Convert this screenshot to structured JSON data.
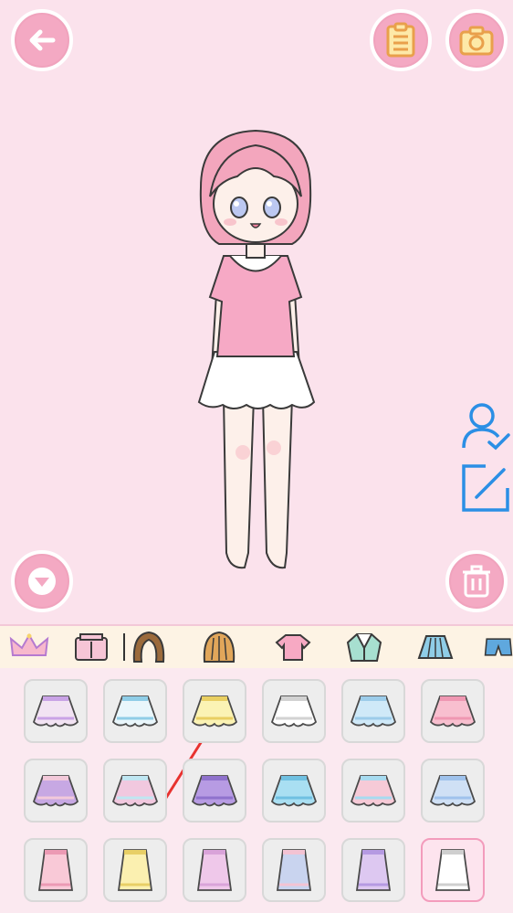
{
  "toolbar": {
    "back": "back-arrow-icon",
    "list": "clipboard-list-icon",
    "camera": "camera-icon",
    "collapse": "chevron-down-icon",
    "delete": "trash-icon"
  },
  "side": {
    "profile": "user-check-icon",
    "edit": "edit-icon"
  },
  "colors": {
    "stage_bg": "#fbe2ec",
    "button_pink": "#f4a9c3",
    "accent_blue": "#2b8fe5",
    "selected_tile": "#fde4ee"
  },
  "categories": [
    {
      "name": "crown-icon",
      "active": true
    },
    {
      "name": "wardrobe-icon",
      "active": false
    },
    {
      "name": "hair-dark-icon",
      "active": false
    },
    {
      "name": "hair-light-icon",
      "active": false
    },
    {
      "name": "shirt-icon",
      "active": false
    },
    {
      "name": "jacket-icon",
      "active": false
    },
    {
      "name": "skirt-icon",
      "active": false
    },
    {
      "name": "shorts-icon",
      "active": false
    }
  ],
  "items": [
    {
      "name": "skirt-tutu-lavender",
      "color": "#f2e3f3",
      "accent": "#c9a3e6"
    },
    {
      "name": "skirt-white-bows",
      "color": "#e9f6fb",
      "accent": "#8fcde7"
    },
    {
      "name": "skirt-yellow-buttons",
      "color": "#fbf3b4",
      "accent": "#e9cf62"
    },
    {
      "name": "skirt-white-asymmetric",
      "color": "#ffffff",
      "accent": "#d2d2d2"
    },
    {
      "name": "skirt-blue-asymmetric",
      "color": "#cfe9f8",
      "accent": "#9cccea"
    },
    {
      "name": "skirt-pink-plain",
      "color": "#f8bfcf",
      "accent": "#ef97b2"
    },
    {
      "name": "skirt-rainbow-pleated",
      "color": "#c7a8e3",
      "accent": "#f2c9da"
    },
    {
      "name": "skirt-pastel-rainbow",
      "color": "#f1c8df",
      "accent": "#bfe6f2"
    },
    {
      "name": "skirt-purple-ruffle",
      "color": "#b79be3",
      "accent": "#8f72cc"
    },
    {
      "name": "skirt-blue-pleated",
      "color": "#a9dff2",
      "accent": "#6fc0e1"
    },
    {
      "name": "skirt-pink-pocket",
      "color": "#f6cad7",
      "accent": "#a7dbf0"
    },
    {
      "name": "skirt-blue-stars",
      "color": "#cfe0f5",
      "accent": "#9fc2ec"
    },
    {
      "name": "skirt-pink-long",
      "color": "#f9c9d7",
      "accent": "#ec9ab4"
    },
    {
      "name": "skirt-yellow-buttoned-long",
      "color": "#fbf0b0",
      "accent": "#e8cf66"
    },
    {
      "name": "skirt-pink-mermaid",
      "color": "#efc8ea",
      "accent": "#d9a3d9"
    },
    {
      "name": "skirt-pastel-stripes-long",
      "color": "#c9d4ef",
      "accent": "#f3c3d3"
    },
    {
      "name": "skirt-purple-puff",
      "color": "#ddc8f1",
      "accent": "#b59ae2"
    },
    {
      "name": "skirt-white-midi",
      "color": "#ffffff",
      "accent": "#cfcfcf",
      "selected": true
    }
  ]
}
